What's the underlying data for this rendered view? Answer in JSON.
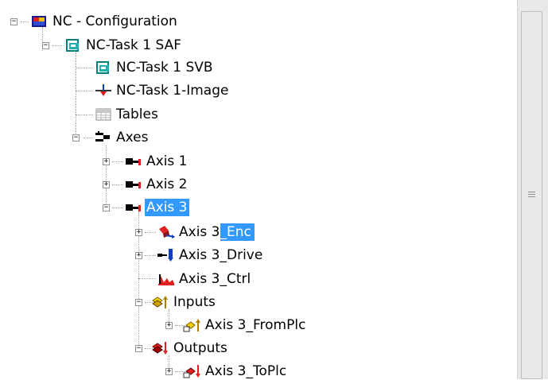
{
  "tree": {
    "nodes": [
      {
        "label": "NC - Configuration",
        "icon": "nc-configuration-icon"
      },
      {
        "label": "NC-Task 1 SAF",
        "icon": "task-icon"
      },
      {
        "label": "NC-Task 1 SVB",
        "icon": "task-icon"
      },
      {
        "label": "NC-Task 1-Image",
        "icon": "image-icon"
      },
      {
        "label": "Tables",
        "icon": "table-icon"
      },
      {
        "label": "Axes",
        "icon": "axes-icon"
      },
      {
        "label": "Axis 1",
        "icon": "axis-icon"
      },
      {
        "label": "Axis 2",
        "icon": "axis-icon"
      },
      {
        "label": "Axis 3",
        "icon": "axis-icon",
        "selected": true
      },
      {
        "label_main": "Axis 3",
        "label_sel": "_Enc",
        "icon": "encoder-icon"
      },
      {
        "label": "Axis 3_Drive",
        "icon": "drive-icon"
      },
      {
        "label": "Axis 3_Ctrl",
        "icon": "controller-icon"
      },
      {
        "label": "Inputs",
        "icon": "inputs-icon"
      },
      {
        "label": "Axis 3_FromPlc",
        "icon": "input-variable-icon"
      },
      {
        "label": "Outputs",
        "icon": "outputs-icon"
      },
      {
        "label": "Axis 3_ToPlc",
        "icon": "output-variable-icon"
      }
    ]
  },
  "colors": {
    "selection": "#3399ff",
    "selection_text": "#ffffff"
  }
}
